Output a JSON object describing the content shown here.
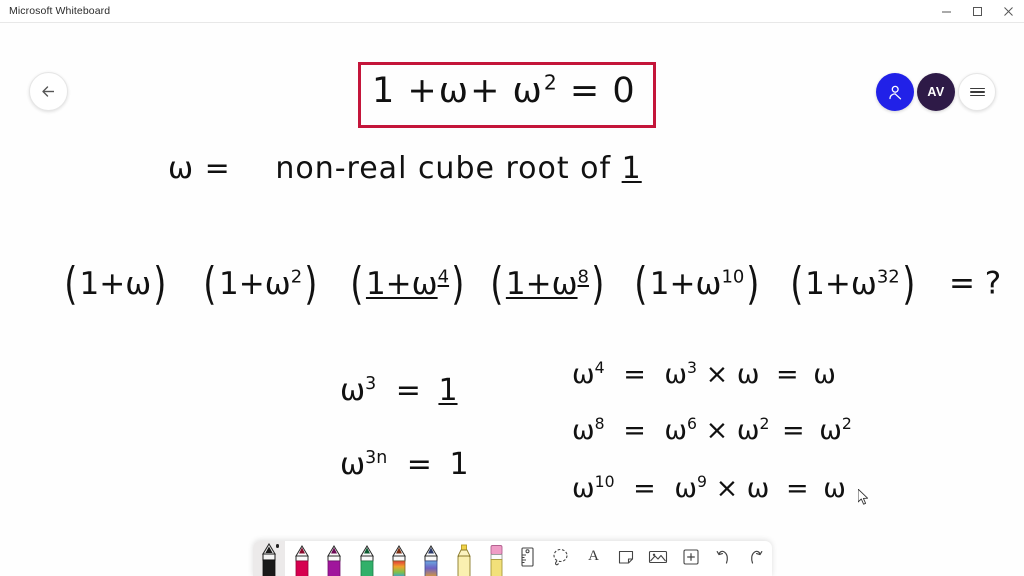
{
  "window": {
    "title": "Microsoft Whiteboard",
    "controls": [
      {
        "name": "minimize",
        "label": "–"
      },
      {
        "name": "maximize",
        "label": "❐"
      },
      {
        "name": "close",
        "label": "✕"
      }
    ]
  },
  "header": {
    "back_button": {
      "icon": "arrow-left-icon",
      "label": ""
    },
    "share_button": {
      "icon": "person-share-icon",
      "label": ""
    },
    "avatar": {
      "initials": "AV"
    },
    "menu_button": {
      "icon": "hamburger-menu-icon",
      "label": ""
    }
  },
  "canvas": {
    "boxed_equation": {
      "text": "1 + ω + ω² = 0",
      "parts": {
        "one": "1",
        "plus1": "+",
        "w": "ω",
        "plus2": "+",
        "w2_base": "ω",
        "w2_exp": "2",
        "equals": "=",
        "zero": "0"
      },
      "border_color": "#c4153a"
    },
    "definition_line": {
      "lhs": "ω  =",
      "rhs_plain": "non-real  cube  root  of",
      "rhs_underlined": "1",
      "full_text": "ω = non-real cube root of 1"
    },
    "product_line": {
      "full_text": "(1+ω) (1+ω²) (1+ω⁴) (1+ω⁸) (1+ω¹⁰) (1+ω³²) = ?",
      "factors": [
        {
          "base": "1+ω",
          "exp": "",
          "underlined": false
        },
        {
          "base": "1+ω",
          "exp": "2",
          "underlined": false
        },
        {
          "base": "1+ω",
          "exp": "4",
          "underlined": true
        },
        {
          "base": "1+ω",
          "exp": "8",
          "underlined": true
        },
        {
          "base": "1+ω",
          "exp": "10",
          "underlined": false
        },
        {
          "base": "1+ω",
          "exp": "32",
          "underlined": false
        }
      ],
      "result": "= ?"
    },
    "left_block": [
      {
        "id": "omega-cubed",
        "text": "ω³ = 1",
        "base": "ω",
        "exp": "3",
        "equals": "=",
        "value": "1",
        "value_underlined": true
      },
      {
        "id": "omega-3n",
        "text": "ω³ⁿ = 1",
        "base": "ω",
        "exp": "3n",
        "equals": "=",
        "value": "1",
        "value_underlined": false
      }
    ],
    "right_block": [
      {
        "id": "omega-4",
        "text": "ω⁴ = ω³ × ω = ω",
        "lhs_base": "ω",
        "lhs_exp": "4",
        "mid_base": "ω",
        "mid_exp": "3",
        "times": "×",
        "mul_base": "ω",
        "mul_exp": "",
        "result_base": "ω",
        "result_exp": ""
      },
      {
        "id": "omega-8",
        "text": "ω⁸ = ω⁶ × ω² = ω²",
        "lhs_base": "ω",
        "lhs_exp": "8",
        "mid_base": "ω",
        "mid_exp": "6",
        "times": "×",
        "mul_base": "ω",
        "mul_exp": "2",
        "result_base": "ω",
        "result_exp": "2"
      },
      {
        "id": "omega-10",
        "text": "ω¹⁰ = ω⁹ × ω = ω",
        "lhs_base": "ω",
        "lhs_exp": "10",
        "mid_base": "ω",
        "mid_exp": "9",
        "times": "×",
        "mul_base": "ω",
        "mul_exp": "",
        "result_base": "ω",
        "result_exp": ""
      }
    ]
  },
  "toolbar": {
    "tools": [
      {
        "name": "pen-black",
        "kind": "pen",
        "color": "#1a1a1a",
        "selected": true
      },
      {
        "name": "pen-red",
        "kind": "pen",
        "color": "#d6004f",
        "selected": false
      },
      {
        "name": "pen-magenta",
        "kind": "pen",
        "color": "#a0169c",
        "selected": false
      },
      {
        "name": "pen-green",
        "kind": "pen",
        "color": "#1f9d55",
        "selected": false
      },
      {
        "name": "pen-rainbow",
        "kind": "pen",
        "color": "#e08a16",
        "selected": false
      },
      {
        "name": "pen-galaxy",
        "kind": "pen",
        "color": "#4a63c8",
        "selected": false
      },
      {
        "name": "highlighter",
        "kind": "highlighter",
        "color": "#f5e06b",
        "selected": false
      },
      {
        "name": "eraser",
        "kind": "eraser",
        "color": "#f0a8c8",
        "selected": false
      },
      {
        "name": "ruler",
        "kind": "icon",
        "icon": "ruler-icon",
        "selected": false
      },
      {
        "name": "lasso-select",
        "kind": "icon",
        "icon": "lasso-icon",
        "selected": false
      },
      {
        "name": "text",
        "kind": "icon",
        "icon": "text-a-icon",
        "label": "A",
        "selected": false
      },
      {
        "name": "sticky-note",
        "kind": "icon",
        "icon": "note-icon",
        "selected": false
      },
      {
        "name": "insert-image",
        "kind": "icon",
        "icon": "image-icon",
        "selected": false
      },
      {
        "name": "insert-more",
        "kind": "icon",
        "icon": "plus-box-icon",
        "selected": false
      },
      {
        "name": "undo",
        "kind": "icon",
        "icon": "undo-icon",
        "selected": false
      },
      {
        "name": "redo",
        "kind": "icon",
        "icon": "redo-icon",
        "selected": false
      }
    ]
  }
}
